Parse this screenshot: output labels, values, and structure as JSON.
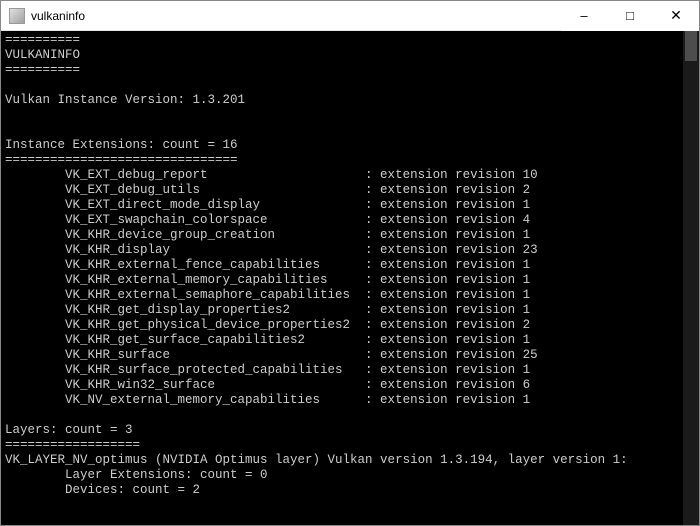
{
  "titlebar": {
    "title": "vulkaninfo",
    "minimize": "–",
    "maximize": "□",
    "close": "✕"
  },
  "content": {
    "rule10": "==========",
    "header": "VULKANINFO",
    "rule10b": "==========",
    "instance_version_label": "Vulkan Instance Version: 1.3.201",
    "ext_header": "Instance Extensions: count = 16",
    "rule31": "===============================",
    "extensions": [
      {
        "name": "VK_EXT_debug_report",
        "rev": "extension revision 10"
      },
      {
        "name": "VK_EXT_debug_utils",
        "rev": "extension revision 2"
      },
      {
        "name": "VK_EXT_direct_mode_display",
        "rev": "extension revision 1"
      },
      {
        "name": "VK_EXT_swapchain_colorspace",
        "rev": "extension revision 4"
      },
      {
        "name": "VK_KHR_device_group_creation",
        "rev": "extension revision 1"
      },
      {
        "name": "VK_KHR_display",
        "rev": "extension revision 23"
      },
      {
        "name": "VK_KHR_external_fence_capabilities",
        "rev": "extension revision 1"
      },
      {
        "name": "VK_KHR_external_memory_capabilities",
        "rev": "extension revision 1"
      },
      {
        "name": "VK_KHR_external_semaphore_capabilities",
        "rev": "extension revision 1"
      },
      {
        "name": "VK_KHR_get_display_properties2",
        "rev": "extension revision 1"
      },
      {
        "name": "VK_KHR_get_physical_device_properties2",
        "rev": "extension revision 2"
      },
      {
        "name": "VK_KHR_get_surface_capabilities2",
        "rev": "extension revision 1"
      },
      {
        "name": "VK_KHR_surface",
        "rev": "extension revision 25"
      },
      {
        "name": "VK_KHR_surface_protected_capabilities",
        "rev": "extension revision 1"
      },
      {
        "name": "VK_KHR_win32_surface",
        "rev": "extension revision 6"
      },
      {
        "name": "VK_NV_external_memory_capabilities",
        "rev": "extension revision 1"
      }
    ],
    "layers_header": "Layers: count = 3",
    "rule18": "==================",
    "layer_line": "VK_LAYER_NV_optimus (NVIDIA Optimus layer) Vulkan version 1.3.194, layer version 1:",
    "layer_ext": "Layer Extensions: count = 0",
    "layer_dev": "Devices: count = 2"
  }
}
